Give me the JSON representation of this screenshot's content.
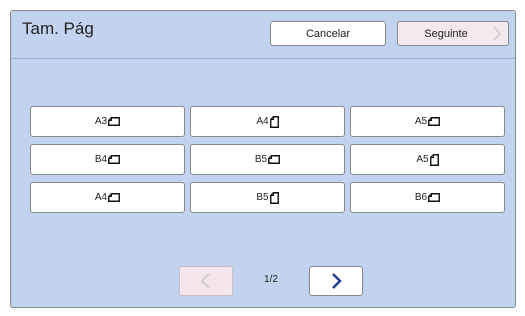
{
  "header": {
    "title": "Tam. Pág",
    "cancel_label": "Cancelar",
    "next_label": "Seguinte"
  },
  "sizes": [
    {
      "label": "A3",
      "orientation": "landscape"
    },
    {
      "label": "A4",
      "orientation": "portrait"
    },
    {
      "label": "A5",
      "orientation": "landscape"
    },
    {
      "label": "B4",
      "orientation": "landscape"
    },
    {
      "label": "B5",
      "orientation": "landscape"
    },
    {
      "label": "A5",
      "orientation": "portrait"
    },
    {
      "label": "A4",
      "orientation": "landscape"
    },
    {
      "label": "B5",
      "orientation": "portrait"
    },
    {
      "label": "B6",
      "orientation": "landscape"
    }
  ],
  "pager": {
    "page_text": "1/2",
    "prev_enabled": false,
    "next_enabled": true
  },
  "colors": {
    "panel": "#c2d3ef",
    "disabled_button": "#f4e6ea",
    "accent": "#1f3f8f"
  }
}
